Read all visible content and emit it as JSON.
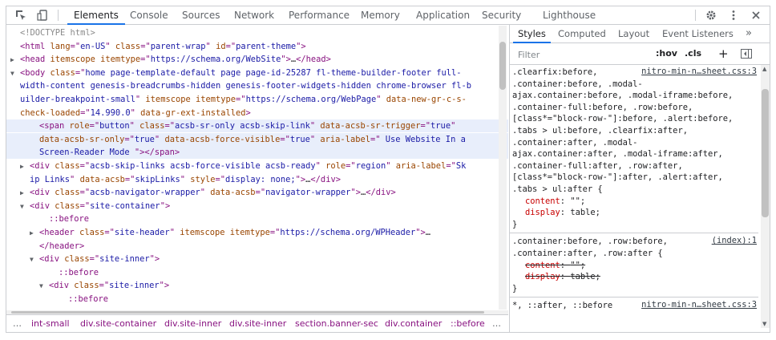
{
  "toolbar": {
    "tabs": [
      "Elements",
      "Console",
      "Sources",
      "Network",
      "Performance",
      "Memory",
      "Application",
      "Security",
      "Lighthouse"
    ],
    "active_tab": "Elements",
    "icons": [
      "inspect-element-icon",
      "device-toolbar-icon",
      "settings-gear-icon",
      "more-options-icon",
      "close-icon"
    ]
  },
  "dom": {
    "lines": [
      {
        "indent": 0,
        "arrow": "",
        "html": [
          [
            "dt",
            "<!DOCTYPE html>"
          ]
        ]
      },
      {
        "indent": 0,
        "arrow": "",
        "html": [
          [
            "tg",
            "<html"
          ],
          [
            "tx",
            " "
          ],
          [
            "at",
            "lang"
          ],
          [
            "tg",
            "=\""
          ],
          [
            "av",
            "en-US"
          ],
          [
            "tg",
            "\""
          ],
          [
            "tx",
            " "
          ],
          [
            "at",
            "class"
          ],
          [
            "tg",
            "=\""
          ],
          [
            "av",
            "parent-wrap"
          ],
          [
            "tg",
            "\""
          ],
          [
            "tx",
            " "
          ],
          [
            "at",
            "id"
          ],
          [
            "tg",
            "=\""
          ],
          [
            "av",
            "parent-theme"
          ],
          [
            "tg",
            "\">"
          ]
        ]
      },
      {
        "indent": 0,
        "arrow": "▶",
        "html": [
          [
            "tg",
            "<head"
          ],
          [
            "tx",
            " "
          ],
          [
            "at",
            "itemscope"
          ],
          [
            "tx",
            " "
          ],
          [
            "at",
            "itemtype"
          ],
          [
            "tg",
            "=\""
          ],
          [
            "av",
            "https://schema.org/WebSite"
          ],
          [
            "tg",
            "\">"
          ],
          [
            "tx",
            "…"
          ],
          [
            "tg",
            "</head>"
          ]
        ]
      },
      {
        "indent": 0,
        "arrow": "▼",
        "html": [
          [
            "tg",
            "<body"
          ],
          [
            "tx",
            " "
          ],
          [
            "at",
            "class"
          ],
          [
            "tg",
            "=\""
          ],
          [
            "av",
            "home page-template-default page page-id-25287 fl-theme-builder-footer full-"
          ]
        ]
      },
      {
        "indent": 0,
        "arrow": "",
        "html": [
          [
            "av",
            "width-content genesis-breadcrumbs-hidden genesis-footer-widgets-hidden chrome-browser fl-b"
          ]
        ]
      },
      {
        "indent": 0,
        "arrow": "",
        "html": [
          [
            "av",
            "uilder-breakpoint-small"
          ],
          [
            "tg",
            "\""
          ],
          [
            "tx",
            " "
          ],
          [
            "at",
            "itemscope"
          ],
          [
            "tx",
            " "
          ],
          [
            "at",
            "itemtype"
          ],
          [
            "tg",
            "=\""
          ],
          [
            "av",
            "https://schema.org/WebPage"
          ],
          [
            "tg",
            "\""
          ],
          [
            "tx",
            " "
          ],
          [
            "at",
            "data-new-gr-c-s-"
          ]
        ]
      },
      {
        "indent": 0,
        "arrow": "",
        "html": [
          [
            "at",
            "check-loaded"
          ],
          [
            "tg",
            "=\""
          ],
          [
            "av",
            "14.990.0"
          ],
          [
            "tg",
            "\""
          ],
          [
            "tx",
            " "
          ],
          [
            "at",
            "data-gr-ext-installed"
          ],
          [
            "tg",
            ">"
          ]
        ]
      },
      {
        "indent": 2,
        "arrow": "",
        "sel": true,
        "html": [
          [
            "tg",
            "<span"
          ],
          [
            "tx",
            " "
          ],
          [
            "at",
            "role"
          ],
          [
            "tg",
            "=\""
          ],
          [
            "av",
            "button"
          ],
          [
            "tg",
            "\""
          ],
          [
            "tx",
            " "
          ],
          [
            "at",
            "class"
          ],
          [
            "tg",
            "=\""
          ],
          [
            "av",
            "acsb-sr-only acsb-skip-link"
          ],
          [
            "tg",
            "\""
          ],
          [
            "tx",
            " "
          ],
          [
            "at",
            "data-acsb-sr-trigger"
          ],
          [
            "tg",
            "=\""
          ],
          [
            "av",
            "true"
          ],
          [
            "tg",
            "\""
          ]
        ]
      },
      {
        "indent": 2,
        "arrow": "",
        "sel": true,
        "html": [
          [
            "at",
            "data-acsb-sr-only"
          ],
          [
            "tg",
            "=\""
          ],
          [
            "av",
            "true"
          ],
          [
            "tg",
            "\""
          ],
          [
            "tx",
            " "
          ],
          [
            "at",
            "data-acsb-force-visible"
          ],
          [
            "tg",
            "=\""
          ],
          [
            "av",
            "true"
          ],
          [
            "tg",
            "\""
          ],
          [
            "tx",
            " "
          ],
          [
            "at",
            "aria-label"
          ],
          [
            "tg",
            "=\""
          ],
          [
            "av",
            " Use Website In a"
          ]
        ]
      },
      {
        "indent": 2,
        "arrow": "",
        "sel": true,
        "html": [
          [
            "av",
            "Screen-Reader Mode "
          ],
          [
            "tg",
            "\">"
          ],
          [
            "tg",
            "</span>"
          ]
        ]
      },
      {
        "indent": 1,
        "arrow": "▶",
        "html": [
          [
            "tg",
            "<div"
          ],
          [
            "tx",
            " "
          ],
          [
            "at",
            "class"
          ],
          [
            "tg",
            "=\""
          ],
          [
            "av",
            "acsb-skip-links acsb-force-visible acsb-ready"
          ],
          [
            "tg",
            "\""
          ],
          [
            "tx",
            " "
          ],
          [
            "at",
            "role"
          ],
          [
            "tg",
            "=\""
          ],
          [
            "av",
            "region"
          ],
          [
            "tg",
            "\""
          ],
          [
            "tx",
            " "
          ],
          [
            "at",
            "aria-label"
          ],
          [
            "tg",
            "=\""
          ],
          [
            "av",
            "Sk"
          ]
        ]
      },
      {
        "indent": 1,
        "arrow": "",
        "html": [
          [
            "av",
            "ip Links"
          ],
          [
            "tg",
            "\""
          ],
          [
            "tx",
            " "
          ],
          [
            "at",
            "data-acsb"
          ],
          [
            "tg",
            "=\""
          ],
          [
            "av",
            "skipLinks"
          ],
          [
            "tg",
            "\""
          ],
          [
            "tx",
            " "
          ],
          [
            "at",
            "style"
          ],
          [
            "tg",
            "=\""
          ],
          [
            "av",
            "display: none;"
          ],
          [
            "tg",
            "\">"
          ],
          [
            "tx",
            "…"
          ],
          [
            "tg",
            "</div>"
          ]
        ]
      },
      {
        "indent": 1,
        "arrow": "▶",
        "html": [
          [
            "tg",
            "<div"
          ],
          [
            "tx",
            " "
          ],
          [
            "at",
            "class"
          ],
          [
            "tg",
            "=\""
          ],
          [
            "av",
            "acsb-navigator-wrapper"
          ],
          [
            "tg",
            "\""
          ],
          [
            "tx",
            " "
          ],
          [
            "at",
            "data-acsb"
          ],
          [
            "tg",
            "=\""
          ],
          [
            "av",
            "navigator-wrapper"
          ],
          [
            "tg",
            "\">"
          ],
          [
            "tx",
            "…"
          ],
          [
            "tg",
            "</div>"
          ]
        ]
      },
      {
        "indent": 1,
        "arrow": "▼",
        "html": [
          [
            "tg",
            "<div"
          ],
          [
            "tx",
            " "
          ],
          [
            "at",
            "class"
          ],
          [
            "tg",
            "=\""
          ],
          [
            "av",
            "site-container"
          ],
          [
            "tg",
            "\">"
          ]
        ]
      },
      {
        "indent": 3,
        "arrow": "",
        "html": [
          [
            "ps",
            "::before"
          ]
        ]
      },
      {
        "indent": 2,
        "arrow": "▶",
        "html": [
          [
            "tg",
            "<header"
          ],
          [
            "tx",
            " "
          ],
          [
            "at",
            "class"
          ],
          [
            "tg",
            "=\""
          ],
          [
            "av",
            "site-header"
          ],
          [
            "tg",
            "\""
          ],
          [
            "tx",
            " "
          ],
          [
            "at",
            "itemscope"
          ],
          [
            "tx",
            " "
          ],
          [
            "at",
            "itemtype"
          ],
          [
            "tg",
            "=\""
          ],
          [
            "av",
            "https://schema.org/WPHeader"
          ],
          [
            "tg",
            "\">"
          ],
          [
            "tx",
            "…"
          ]
        ]
      },
      {
        "indent": 2,
        "arrow": "",
        "html": [
          [
            "tg",
            "</header>"
          ]
        ]
      },
      {
        "indent": 2,
        "arrow": "▼",
        "html": [
          [
            "tg",
            "<div"
          ],
          [
            "tx",
            " "
          ],
          [
            "at",
            "class"
          ],
          [
            "tg",
            "=\""
          ],
          [
            "av",
            "site-inner"
          ],
          [
            "tg",
            "\">"
          ]
        ]
      },
      {
        "indent": 4,
        "arrow": "",
        "html": [
          [
            "ps",
            "::before"
          ]
        ]
      },
      {
        "indent": 3,
        "arrow": "▼",
        "html": [
          [
            "tg",
            "<div"
          ],
          [
            "tx",
            " "
          ],
          [
            "at",
            "class"
          ],
          [
            "tg",
            "=\""
          ],
          [
            "av",
            "site-inner"
          ],
          [
            "tg",
            "\">"
          ]
        ]
      },
      {
        "indent": 5,
        "arrow": "",
        "html": [
          [
            "ps",
            "::before"
          ]
        ]
      }
    ]
  },
  "breadcrumbs": {
    "more_left": "…",
    "items": [
      "int-small",
      "div.site-container",
      "div.site-inner",
      "div.site-inner",
      "section.banner-sec",
      "div.container",
      "::before"
    ],
    "more_right": "…"
  },
  "styles": {
    "tabs": [
      "Styles",
      "Computed",
      "Layout",
      "Event Listeners"
    ],
    "active_tab": "Styles",
    "more": "»",
    "filter_placeholder": "Filter",
    "hov": ":hov",
    "cls": ".cls",
    "plus": "+",
    "rules": [
      {
        "source": "nitro-min-n…sheet.css:3",
        "selector_lines": [
          ".clearfix:before,",
          ".container:before, .modal-",
          "ajax.container:before, .modal-iframe:before,",
          ".container-full:before, .row:before,",
          "[class*=\"block-row-\"]:before, .alert:before,",
          ".tabs > ul:before, .clearfix:after,",
          ".container:after, .modal-",
          "ajax.container:after, .modal-iframe:after,",
          ".container-full:after, .row:after,",
          "[class*=\"block-row-\"]:after, .alert:after,",
          ".tabs > ul:after {"
        ],
        "props": [
          {
            "name": "content",
            "value": "\"\"",
            "struck": false
          },
          {
            "name": "display",
            "value": "table",
            "struck": false
          }
        ],
        "close": "}"
      },
      {
        "source": "(index):1",
        "selector_lines": [
          ".container:before, .row:before,",
          ".container:after, .row:after {"
        ],
        "props": [
          {
            "name": "content",
            "value": "\"\"",
            "struck": true
          },
          {
            "name": "display",
            "value": "table",
            "struck": true
          }
        ],
        "close": "}"
      },
      {
        "source": "nitro-min-n…sheet.css:3",
        "selector_lines": [
          "*, ::after, ::before"
        ],
        "props": [],
        "close": ""
      }
    ]
  }
}
